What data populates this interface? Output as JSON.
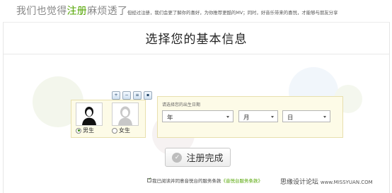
{
  "header": {
    "title_pre": "我们也觉得",
    "title_highlight": "注册",
    "title_post": "麻烦透了",
    "description": "但经过注册，我们会更了解你的喜好，为你推荐更酷的MV；同时，好音乐带来的喜悦，才能够与朋友分享"
  },
  "card": {
    "title": "选择您的基本信息"
  },
  "gender": {
    "male_label": "男生",
    "female_label": "女生",
    "selected": "male"
  },
  "birthdate": {
    "label": "请选择您的出生日期",
    "year_value": "年",
    "month_value": "月",
    "day_value": "日"
  },
  "toolbar": {
    "icons": [
      "zoom-in-icon",
      "zoom-out-icon",
      "print-icon",
      "save-icon"
    ]
  },
  "submit": {
    "label": "注册完成"
  },
  "agreement": {
    "checked": true,
    "text_pre": "我已阅读并同意音悦台的服务条款",
    "link_text": "《音悦台服务条款》"
  },
  "watermark": {
    "cn": "思缘设计论坛",
    "en": "www.MISSYUAN.COM"
  },
  "colors": {
    "accent": "#52a400",
    "panel_bg": "#fdfbe7",
    "panel_border": "#e8dfad"
  }
}
